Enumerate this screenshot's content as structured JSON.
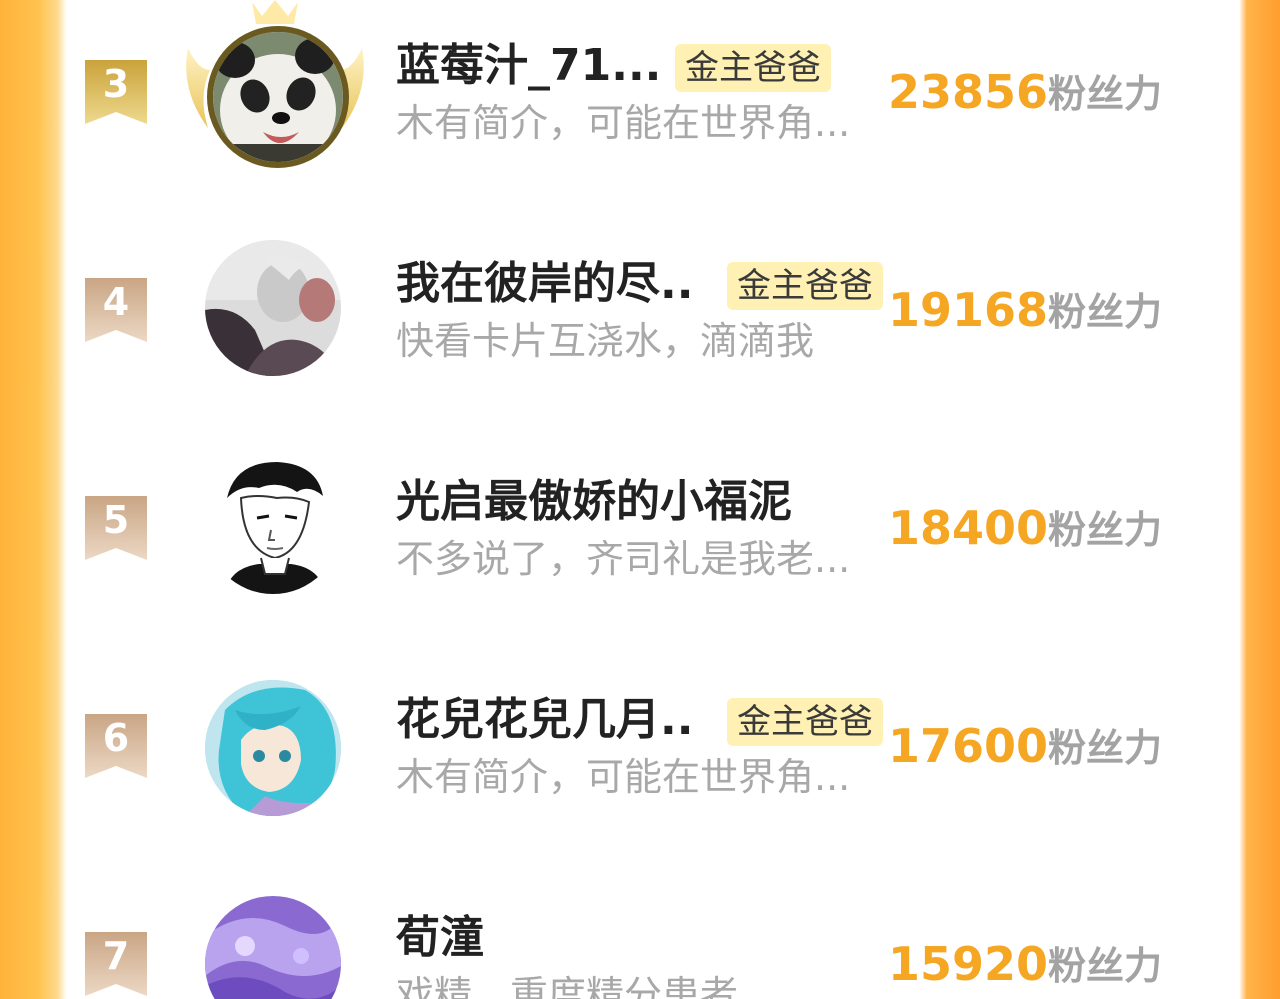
{
  "ranking": {
    "score_suffix": "粉丝力",
    "entries": [
      {
        "rank": "3",
        "name": "蓝莓汁_71...",
        "tag": "金主爸爸",
        "bio": "木有简介，可能在世界角...",
        "score": "23856",
        "avatar": "panda-avatar",
        "badge_style": "gold"
      },
      {
        "rank": "4",
        "name": "我在彼岸的尽..",
        "tag": "金主爸爸",
        "bio": "快看卡片互浇水，滴滴我",
        "score": "19168",
        "avatar": "anime-couple-avatar",
        "badge_style": "tan"
      },
      {
        "rank": "5",
        "name": "光启最傲娇的小福泥",
        "tag": "",
        "bio": "不多说了，齐司礼是我老...",
        "score": "18400",
        "avatar": "black-haired-man-avatar",
        "badge_style": "tan"
      },
      {
        "rank": "6",
        "name": "花兒花兒几月..",
        "tag": "金主爸爸",
        "bio": "木有简介，可能在世界角...",
        "score": "17600",
        "avatar": "cyan-haired-girl-avatar",
        "badge_style": "tan"
      },
      {
        "rank": "7",
        "name": "荀潼",
        "tag": "",
        "bio": "戏精，重度精分患者",
        "score": "15920",
        "avatar": "purple-abstract-avatar",
        "badge_style": "tan"
      }
    ]
  },
  "colors": {
    "score": "#f5a623",
    "tag_bg": "#fff1b3",
    "badge_gold": "#d8b24a",
    "badge_tan": "#d6b79a",
    "frame_orange": "#ffad3a"
  }
}
